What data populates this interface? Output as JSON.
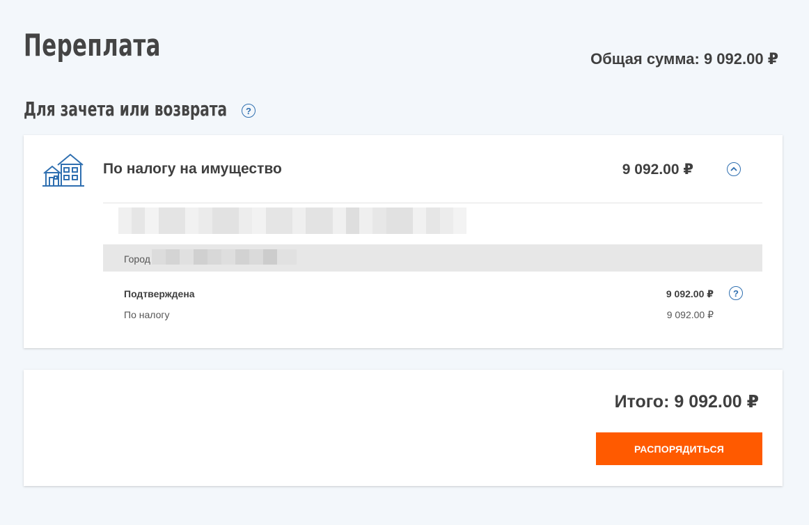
{
  "header": {
    "title": "Переплата",
    "total_label": "Общая сумма: 9 092.00 ₽"
  },
  "section": {
    "title": "Для зачета или возврата",
    "help_icon": "?"
  },
  "tax_card": {
    "icon": "house-icon",
    "title": "По налогу на имущество",
    "amount": "9 092.00 ₽",
    "address_redacted": true,
    "city_label": "Город",
    "status_label": "Подтверждена",
    "status_amount": "9 092.00 ₽",
    "status_help": "?",
    "sub_label": "По налогу",
    "sub_amount": "9 092.00 ₽"
  },
  "total_card": {
    "total_text": "Итого: 9 092.00 ₽",
    "button_label": "РАСПОРЯДИТЬСЯ"
  },
  "colors": {
    "background": "#f3f7fb",
    "accent_blue": "#2f6fb0",
    "action_orange": "#ff5a00"
  }
}
